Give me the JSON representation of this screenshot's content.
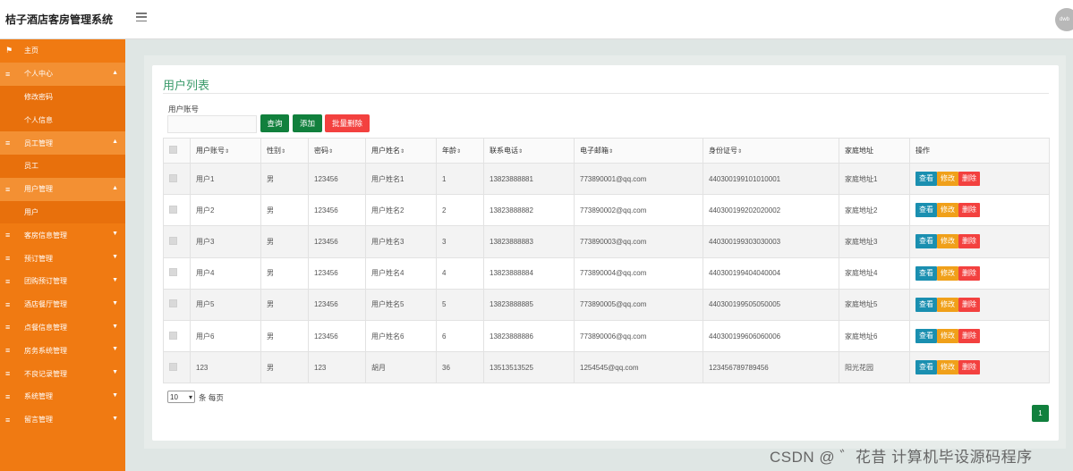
{
  "app": {
    "title": "桔子酒店客房管理系统",
    "avatar_text": "dwb"
  },
  "sidebar": {
    "items": [
      {
        "label": "主页",
        "icon": "flag-icon",
        "kind": "top",
        "caret": ""
      },
      {
        "label": "个人中心",
        "icon": "menu-icon",
        "kind": "group-open",
        "caret": "▲"
      },
      {
        "label": "修改密码",
        "icon": "",
        "kind": "sub",
        "caret": ""
      },
      {
        "label": "个人信息",
        "icon": "",
        "kind": "sub",
        "caret": ""
      },
      {
        "label": "员工管理",
        "icon": "menu-icon",
        "kind": "group-open",
        "caret": "▲"
      },
      {
        "label": "员工",
        "icon": "",
        "kind": "sub",
        "caret": ""
      },
      {
        "label": "用户管理",
        "icon": "menu-icon",
        "kind": "group-open",
        "caret": "▲"
      },
      {
        "label": "用户",
        "icon": "",
        "kind": "sub",
        "caret": ""
      },
      {
        "label": "客房信息管理",
        "icon": "menu-icon",
        "kind": "top",
        "caret": "▼"
      },
      {
        "label": "预订管理",
        "icon": "menu-icon",
        "kind": "top",
        "caret": "▼"
      },
      {
        "label": "团购预订管理",
        "icon": "menu-icon",
        "kind": "top",
        "caret": "▼"
      },
      {
        "label": "酒店餐厅管理",
        "icon": "menu-icon",
        "kind": "top",
        "caret": "▼"
      },
      {
        "label": "点餐信息管理",
        "icon": "menu-icon",
        "kind": "top",
        "caret": "▼"
      },
      {
        "label": "房务系统管理",
        "icon": "menu-icon",
        "kind": "top",
        "caret": "▼"
      },
      {
        "label": "不良记录管理",
        "icon": "menu-icon",
        "kind": "top",
        "caret": "▼"
      },
      {
        "label": "系统管理",
        "icon": "menu-icon",
        "kind": "top",
        "caret": "▼"
      },
      {
        "label": "留言管理",
        "icon": "menu-icon",
        "kind": "top",
        "caret": "▼"
      }
    ]
  },
  "main": {
    "title": "用户列表",
    "search": {
      "label": "用户账号",
      "value": "",
      "placeholder": ""
    },
    "buttons": {
      "search": "查询",
      "add": "添加",
      "batch_delete": "批量删除"
    },
    "table": {
      "columns": [
        "用户账号",
        "性别",
        "密码",
        "用户姓名",
        "年龄",
        "联系电话",
        "电子邮箱",
        "身份证号",
        "家庭地址",
        "操作"
      ],
      "sort_icon": "⇕",
      "actions": {
        "view": "查看",
        "edit": "修改",
        "delete": "删除"
      },
      "rows": [
        [
          "用户1",
          "男",
          "123456",
          "用户姓名1",
          "1",
          "13823888881",
          "773890001@qq.com",
          "440300199101010001",
          "家庭地址1"
        ],
        [
          "用户2",
          "男",
          "123456",
          "用户姓名2",
          "2",
          "13823888882",
          "773890002@qq.com",
          "440300199202020002",
          "家庭地址2"
        ],
        [
          "用户3",
          "男",
          "123456",
          "用户姓名3",
          "3",
          "13823888883",
          "773890003@qq.com",
          "440300199303030003",
          "家庭地址3"
        ],
        [
          "用户4",
          "男",
          "123456",
          "用户姓名4",
          "4",
          "13823888884",
          "773890004@qq.com",
          "440300199404040004",
          "家庭地址4"
        ],
        [
          "用户5",
          "男",
          "123456",
          "用户姓名5",
          "5",
          "13823888885",
          "773890005@qq.com",
          "440300199505050005",
          "家庭地址5"
        ],
        [
          "用户6",
          "男",
          "123456",
          "用户姓名6",
          "6",
          "13823888886",
          "773890006@qq.com",
          "440300199606060006",
          "家庭地址6"
        ],
        [
          "123",
          "男",
          "123",
          "胡月",
          "36",
          "13513513525",
          "1254545@qq.com",
          "123456789789456",
          "阳光花园"
        ]
      ]
    },
    "pagination": {
      "page_size": "10",
      "page_size_suffix": "条 每页",
      "current_page": "1"
    }
  },
  "watermark": "CSDN @ ゛花昔 计算机毕设源码程序",
  "colors": {
    "sidebar": "#f07a12",
    "accent_green": "#11803d",
    "danger": "#f3413f",
    "view": "#1a8fb0",
    "edit": "#f0a01a",
    "title_green": "#3a9a6a"
  }
}
